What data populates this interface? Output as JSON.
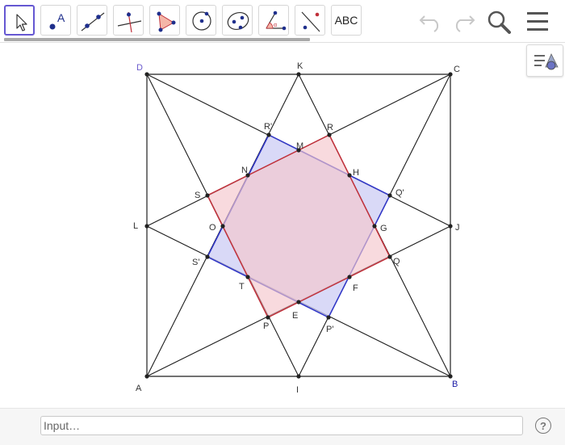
{
  "toolbar": {
    "tools": [
      {
        "name": "move-tool",
        "icon": "arrow-pointer-icon"
      },
      {
        "name": "point-tool",
        "icon": "point-icon",
        "text": "A"
      },
      {
        "name": "line-tool",
        "icon": "line-through-points-icon"
      },
      {
        "name": "perpendicular-line-tool",
        "icon": "perpendicular-line-icon"
      },
      {
        "name": "polygon-tool",
        "icon": "polygon-icon"
      },
      {
        "name": "circle-tool",
        "icon": "circle-center-point-icon"
      },
      {
        "name": "ellipse-tool",
        "icon": "ellipse-icon"
      },
      {
        "name": "angle-tool",
        "icon": "angle-icon"
      },
      {
        "name": "reflect-tool",
        "icon": "reflect-about-line-icon"
      },
      {
        "name": "text-tool",
        "icon": "text-icon",
        "text": "ABC"
      }
    ],
    "selected_tool": "move-tool"
  },
  "colors": {
    "red_polygon_stroke": "#c0303a",
    "red_polygon_fill": "#f5c6cc",
    "blue_polygon_stroke": "#2f35c8",
    "blue_polygon_fill": "#ccccf4",
    "selected_tool_border": "#6557d2",
    "line_color": "#1e1e1e"
  },
  "canvas": {
    "labels": {
      "A": "A",
      "B": "B",
      "C": "C",
      "D": "D",
      "K": "K",
      "J": "J",
      "I": "I",
      "L": "L",
      "R_prime": "R'",
      "R": "R",
      "M": "M",
      "N": "N",
      "H": "H",
      "S": "S",
      "Q_prime": "Q'",
      "O": "O",
      "G": "G",
      "S_prime": "S'",
      "Q": "Q",
      "T": "T",
      "F": "F",
      "E": "E",
      "P": "P",
      "P_prime": "P'"
    }
  },
  "input_bar": {
    "placeholder": "Input…",
    "value": ""
  },
  "help_button": {
    "label": "?"
  }
}
